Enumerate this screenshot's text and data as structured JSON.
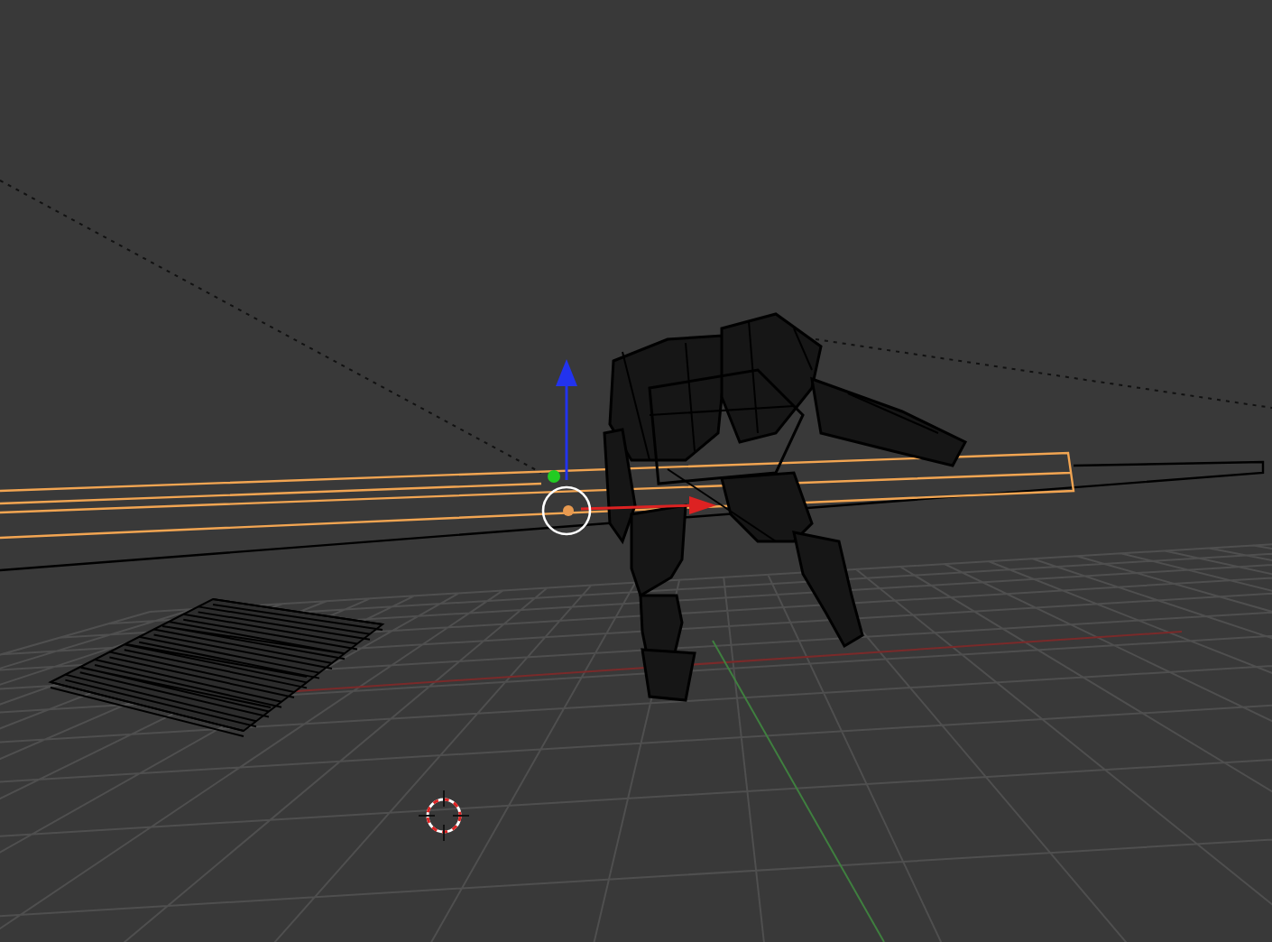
{
  "viewport": {
    "objects": [
      {
        "kind": "beam",
        "selected": true
      },
      {
        "kind": "robot",
        "selected": false
      },
      {
        "kind": "pallet",
        "selected": false
      }
    ]
  }
}
